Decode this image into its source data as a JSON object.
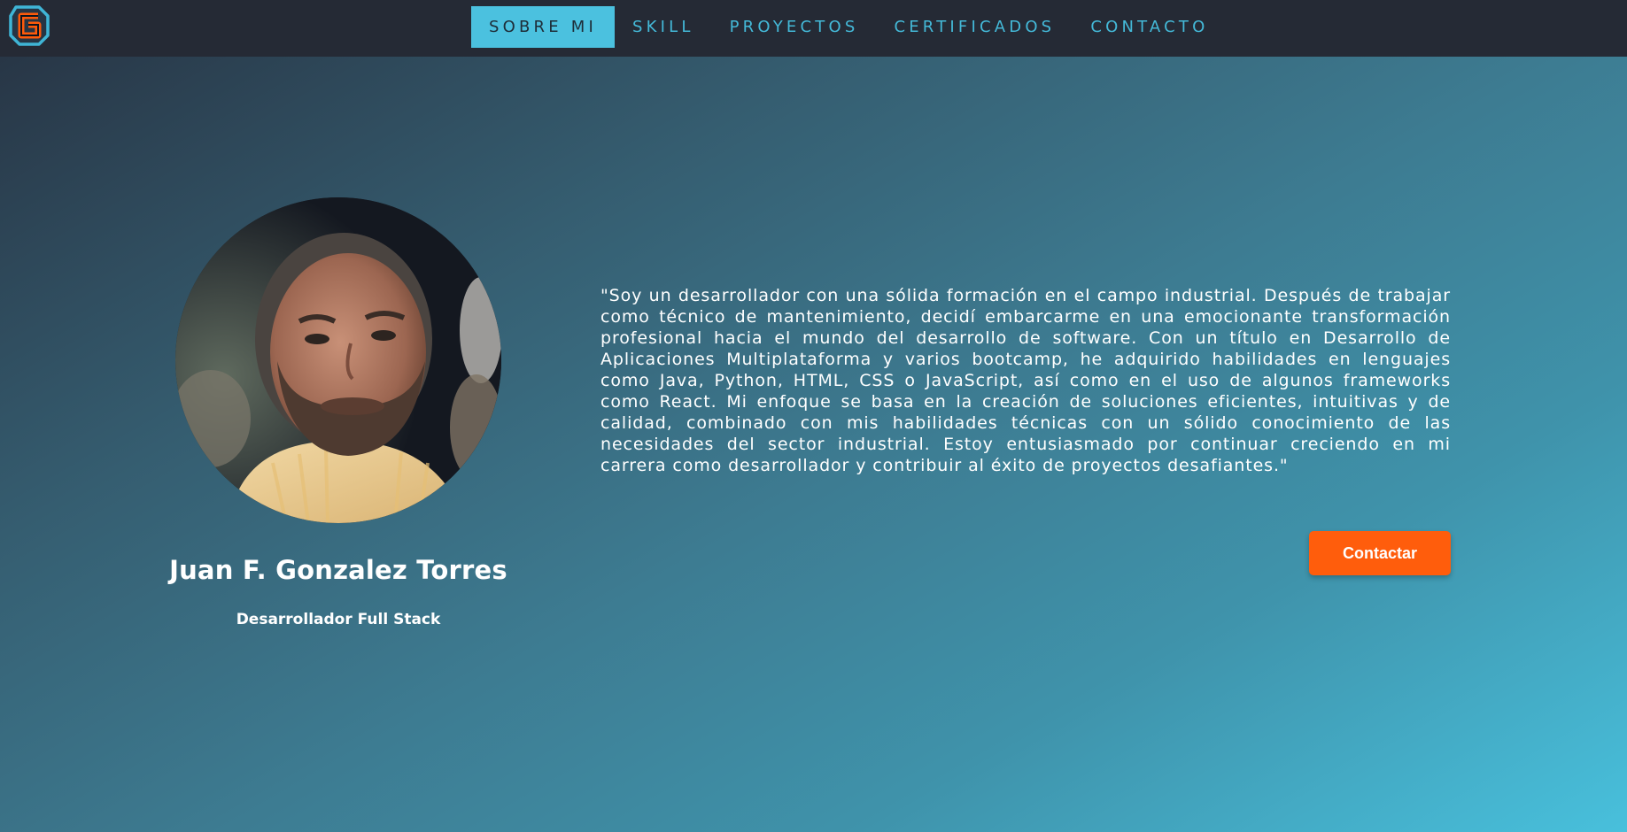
{
  "nav": {
    "items": [
      {
        "label": "SOBRE MI",
        "active": true
      },
      {
        "label": "SKILL",
        "active": false
      },
      {
        "label": "PROYECTOS",
        "active": false
      },
      {
        "label": "CERTIFICADOS",
        "active": false
      },
      {
        "label": "CONTACTO",
        "active": false
      }
    ],
    "logo_icon": "brand-logo-icon"
  },
  "profile": {
    "name": "Juan F. Gonzalez Torres",
    "role": "Desarrollador Full Stack",
    "photo": "profile-photo"
  },
  "about": {
    "bio": "\"Soy un desarrollador con una sólida formación en el campo industrial. Después de trabajar como técnico de mantenimiento, decidí embarcarme en una emocionante transformación profesional hacia el mundo del desarrollo de software. Con un título en Desarrollo de Aplicaciones Multiplataforma y varios bootcamp, he adquirido habilidades en lenguajes como Java, Python, HTML, CSS o JavaScript, así como en el uso de algunos frameworks como React. Mi enfoque se basa en la creación de soluciones eficientes, intuitivas y de calidad, combinado con mis habilidades técnicas con un sólido conocimiento de las necesidades del sector industrial. Estoy entusiasmado por continuar creciendo en mi carrera como desarrollador y contribuir al éxito de proyectos desafiantes.\"",
    "cta_label": "Contactar"
  },
  "colors": {
    "nav_bg": "#252a35",
    "accent_cyan": "#4bc1df",
    "accent_orange": "#ff5d0c",
    "text_white": "#ffffff"
  }
}
